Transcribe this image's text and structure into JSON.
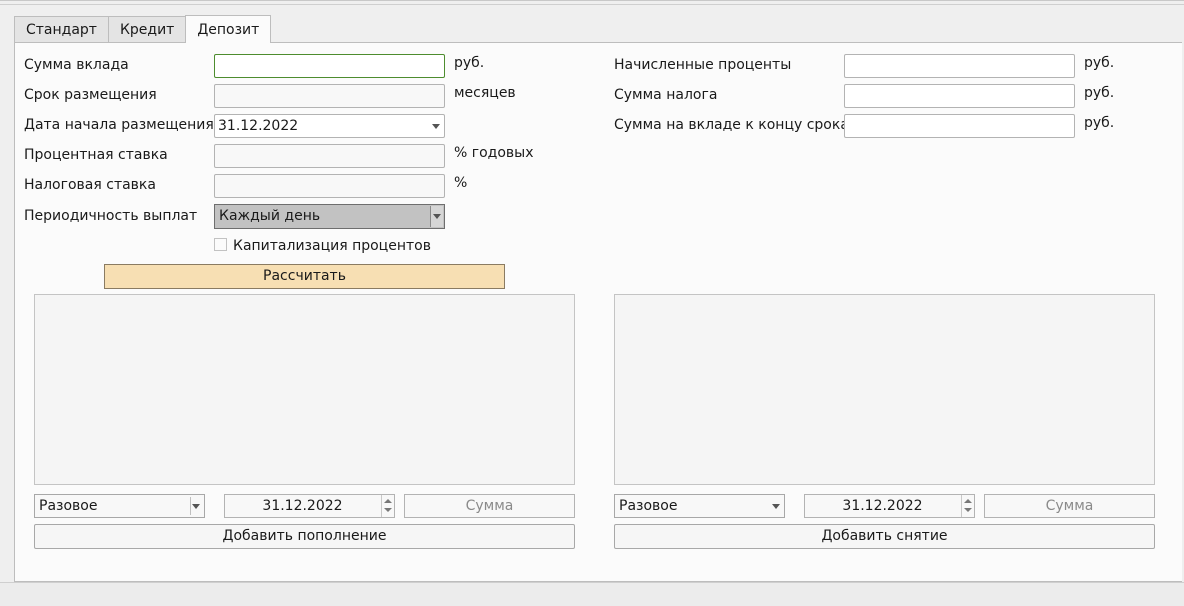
{
  "tabs": [
    {
      "label": "Стандарт"
    },
    {
      "label": "Кредит"
    },
    {
      "label": "Депозит"
    }
  ],
  "form": {
    "deposit_amount_label": "Сумма вклада",
    "deposit_amount_unit": "руб.",
    "term_label": "Срок размещения",
    "term_unit": "месяцев",
    "start_date_label": "Дата начала размещения",
    "start_date_value": "31.12.2022",
    "interest_rate_label": "Процентная ставка",
    "interest_rate_unit": "% годовых",
    "tax_rate_label": "Налоговая ставка",
    "tax_rate_unit": "%",
    "payout_label": "Периодичность выплат",
    "payout_value": "Каждый день",
    "capitalization_label": "Капитализация процентов",
    "capitalization_checked": false,
    "calculate_label": "Рассчитать"
  },
  "results": {
    "accrued_interest_label": "Начисленные проценты",
    "accrued_interest_unit": "руб.",
    "tax_amount_label": "Сумма налога",
    "tax_amount_unit": "руб.",
    "final_amount_label": "Сумма на вкладе к концу срока",
    "final_amount_unit": "руб."
  },
  "replenishment": {
    "type_value": "Разовое",
    "date_value": "31.12.2022",
    "amount_placeholder": "Сумма",
    "add_button": "Добавить пополнение"
  },
  "withdrawal": {
    "type_value": "Разовое",
    "date_value": "31.12.2022",
    "amount_placeholder": "Сумма",
    "add_button": "Добавить снятие"
  }
}
